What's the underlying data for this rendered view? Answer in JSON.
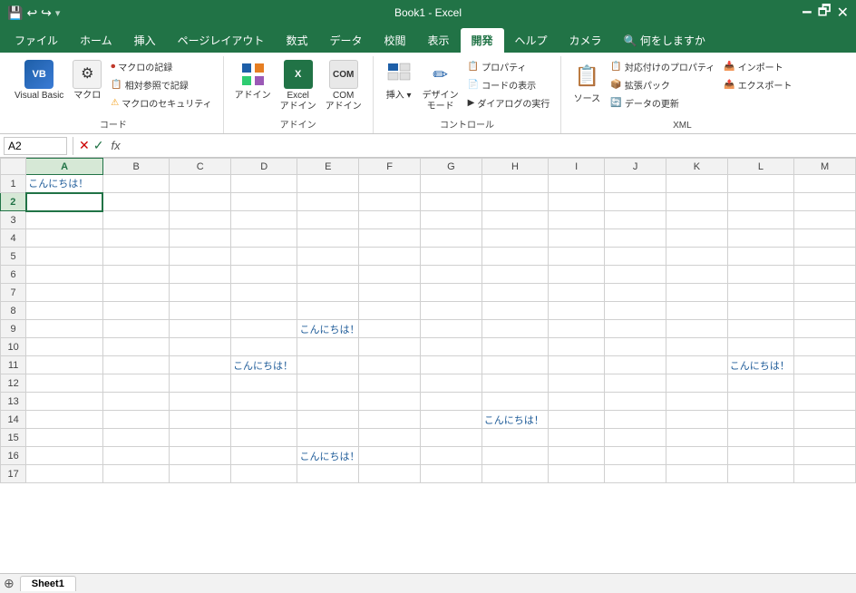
{
  "titlebar": {
    "title": "Book1 - Excel",
    "save_icon": "💾",
    "undo_icon": "↩",
    "redo_icon": "↪"
  },
  "ribbon_tabs": [
    {
      "label": "ファイル",
      "id": "file",
      "active": false
    },
    {
      "label": "ホーム",
      "id": "home",
      "active": false
    },
    {
      "label": "挿入",
      "id": "insert",
      "active": false
    },
    {
      "label": "ページレイアウト",
      "id": "pagelayout",
      "active": false
    },
    {
      "label": "数式",
      "id": "formula",
      "active": false
    },
    {
      "label": "データ",
      "id": "data",
      "active": false
    },
    {
      "label": "校閲",
      "id": "review",
      "active": false
    },
    {
      "label": "表示",
      "id": "view",
      "active": false
    },
    {
      "label": "開発",
      "id": "developer",
      "active": true
    },
    {
      "label": "ヘルプ",
      "id": "help",
      "active": false
    },
    {
      "label": "カメラ",
      "id": "camera",
      "active": false
    },
    {
      "label": "🔍 何をしますか",
      "id": "search",
      "active": false
    }
  ],
  "ribbon_groups": {
    "code": {
      "label": "コード",
      "buttons": [
        {
          "label": "Visual Basic",
          "icon": "VB"
        },
        {
          "label": "マクロ",
          "icon": "⚙"
        }
      ],
      "small_buttons": [
        {
          "label": "マクロの記録",
          "icon": "⏺"
        },
        {
          "label": "相対参照で記録",
          "icon": "📋"
        },
        {
          "label": "マクロのセキュリティ",
          "icon": "⚠"
        }
      ]
    },
    "addin": {
      "label": "アドイン",
      "buttons": [
        {
          "label": "アドイン",
          "icon": "🔷"
        },
        {
          "label": "Excel アドイン",
          "icon": "📗"
        },
        {
          "label": "COM アドイン",
          "icon": "COM"
        }
      ]
    },
    "control": {
      "label": "コントロール",
      "buttons": [
        {
          "label": "挿入",
          "icon": "⬛"
        },
        {
          "label": "デザイン モード",
          "icon": "✏"
        }
      ],
      "small_buttons": [
        {
          "label": "プロパティ",
          "icon": "📋"
        },
        {
          "label": "コードの表示",
          "icon": "📄"
        },
        {
          "label": "ダイアログの実行",
          "icon": "▶"
        }
      ]
    },
    "xml": {
      "label": "XML",
      "buttons": [
        {
          "label": "ソース",
          "icon": "📋"
        }
      ],
      "small_buttons": [
        {
          "label": "対応付けのプロパティ",
          "icon": "📋"
        },
        {
          "label": "拡張パック",
          "icon": "📦"
        },
        {
          "label": "データの更新",
          "icon": "🔄"
        },
        {
          "label": "インポート",
          "icon": "📥"
        },
        {
          "label": "エクスポート",
          "icon": "📤"
        }
      ]
    }
  },
  "formula_bar": {
    "name_box": "A2",
    "fx_label": "fx"
  },
  "spreadsheet": {
    "columns": [
      "A",
      "B",
      "C",
      "D",
      "E",
      "F",
      "G",
      "H",
      "I",
      "J",
      "K",
      "L",
      "M"
    ],
    "selected_cell": "A2",
    "cells": {
      "A1": "こんにちは！",
      "E9": "こんにちは！",
      "D11": "こんにちは！",
      "H14": "こんにちは！",
      "E16": "こんにちは！",
      "L11": "こんにちは！"
    },
    "rows": 17
  },
  "sheet_tabs": [
    {
      "label": "Sheet1",
      "active": true
    }
  ]
}
